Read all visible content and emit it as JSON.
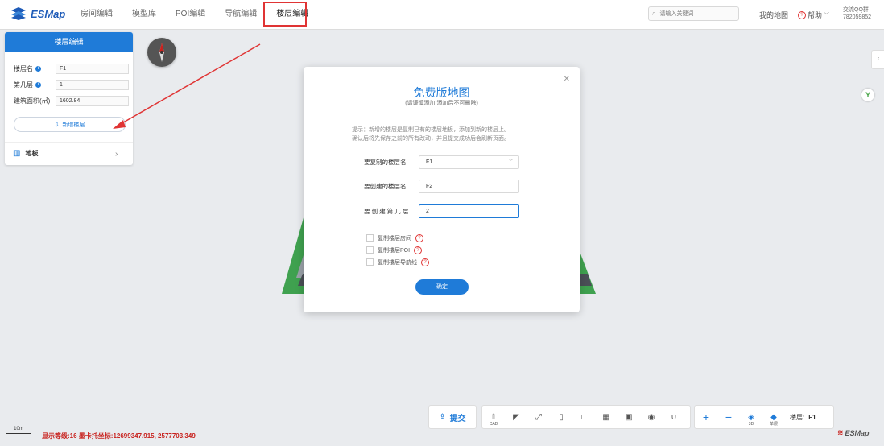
{
  "app": {
    "brand": "ESMap"
  },
  "nav": {
    "tabs": [
      "房间编辑",
      "模型库",
      "POI编辑",
      "导航编辑",
      "楼层编辑"
    ],
    "active_index": 4
  },
  "header": {
    "search_placeholder": "请输入关键词",
    "my_map": "我的地图",
    "help": "帮助",
    "qq_label": "交流QQ群",
    "qq_number": "782059852"
  },
  "panel": {
    "title": "楼层编辑",
    "floor_name_label": "楼层名",
    "floor_name_value": "F1",
    "floor_num_label": "第几层",
    "floor_num_value": "1",
    "area_label": "建筑面积(㎡)",
    "area_value": "1602.84",
    "add_floor": "新增楼层",
    "floorboard": "地板"
  },
  "modal": {
    "title": "免费版地图",
    "subtitle": "(请谨慎添加,添加后不可删除)",
    "tip_line1": "提示：新增的楼层是复制已有的楼层地板，添加到新的楼层上。",
    "tip_line2": "确认后将先保存之前的所有改动，并且提交成功后会刷新页面。",
    "copy_floor_label": "要复制的楼层名",
    "copy_floor_value": "F1",
    "create_floor_label": "要创建的楼层名",
    "create_floor_value": "F2",
    "create_num_label": "要 创 建 第 几 层",
    "create_num_value": "2",
    "checks": [
      "复制楼层房间",
      "复制楼层POI",
      "复制楼层导航线"
    ],
    "ok": "确定"
  },
  "toolbar": {
    "submit": "提交",
    "cad": "CAD",
    "view_3d": "3D",
    "view_single": "单层",
    "floor_label": "楼层:",
    "floor_value": "F1"
  },
  "status": {
    "text": "显示等级:16  墨卡托坐标:12699347.915, 2577703.349",
    "scale": "10m"
  },
  "colors": {
    "accent": "#1f7bd8",
    "alert": "#e03434"
  }
}
